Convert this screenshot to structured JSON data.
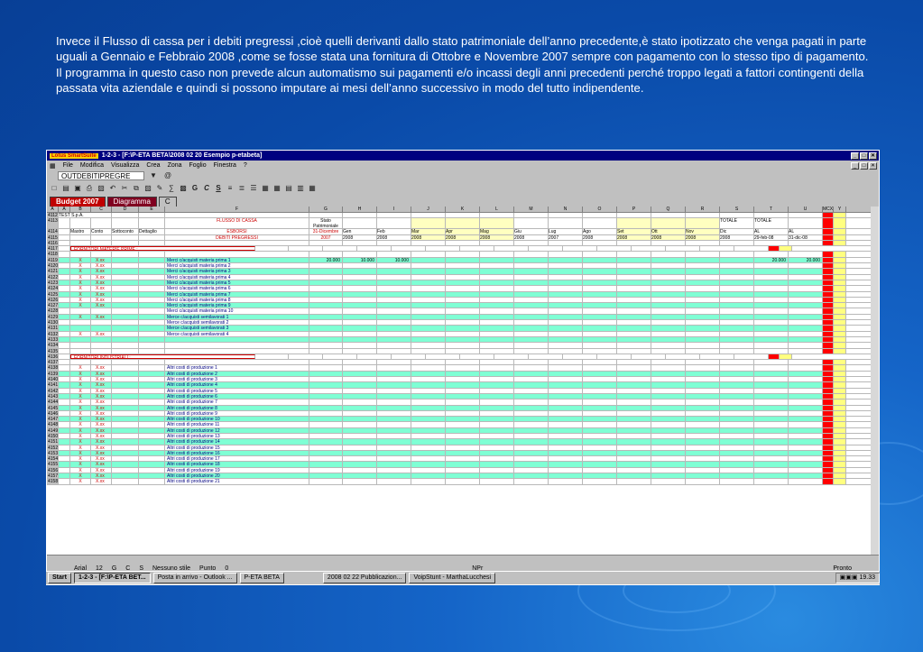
{
  "caption": "Invece il Flusso di cassa per i debiti pregressi ,cioè quelli derivanti dallo stato patrimoniale dell’anno precedente,è stato ipotizzato che venga pagati in parte uguali a Gennaio e Febbraio 2008 ,come se fosse stata una fornitura di Ottobre e Novembre 2007 sempre con pagamento con lo stesso tipo di pagamento. Il programma in questo caso non prevede alcun automatismo sui pagamenti e/o incassi degli anni precedenti perché troppo legati a fattori contingenti della passata vita aziendale e quindi si possono imputare ai mesi dell’anno successivo in modo del tutto indipendente.",
  "window": {
    "title": "1-2-3 - [F:\\P-ETA BETA\\2008 02 20 Esempio p-etabeta]",
    "logo_text": "Lotus SmartSuite"
  },
  "menu": [
    "File",
    "Modifica",
    "Visualizza",
    "Crea",
    "Zona",
    "Foglio",
    "Finestra",
    "?"
  ],
  "name_box": "OUTDEBITIPREGRE",
  "toolbar_letters": {
    "bold": "G",
    "italic": "C",
    "underline": "S"
  },
  "tabs": [
    "Budget 2007",
    "Diagramma",
    "C"
  ],
  "columns": [
    "A",
    "A",
    "B",
    "C",
    "D",
    "E",
    "F",
    "G",
    "H",
    "I",
    "J",
    "K",
    "L",
    "M",
    "N",
    "O",
    "P",
    "Q",
    "R",
    "S",
    "T",
    "U",
    "MCX",
    "Y"
  ],
  "header": {
    "company": "TEST S.p.A.",
    "title1": "FLUSSO DI CASSA",
    "title2": "ESBORSI",
    "title3": "DEBITI PREGRESSI",
    "col_mastro": "Mastro",
    "col_conto": "Conto",
    "col_sottoconto": "Sottoconto",
    "col_dettaglio": "Dettaglio",
    "stato": [
      "Stato",
      "Patrimoniale",
      "31-Dicembre",
      "2007"
    ],
    "months": [
      {
        "m": "Gen",
        "y": "2008"
      },
      {
        "m": "Feb",
        "y": "2008"
      },
      {
        "m": "Mar",
        "y": "2008"
      },
      {
        "m": "Apr",
        "y": "2008"
      },
      {
        "m": "Mag",
        "y": "2008"
      },
      {
        "m": "Giu",
        "y": "2008"
      },
      {
        "m": "Lug",
        "y": "2007"
      },
      {
        "m": "Ago",
        "y": "2008"
      },
      {
        "m": "Set",
        "y": "2008"
      },
      {
        "m": "Ott",
        "y": "2008"
      },
      {
        "m": "Nov",
        "y": "2008"
      },
      {
        "m": "Dic",
        "y": "2008"
      }
    ],
    "totale1": [
      "TOTALE",
      "AL",
      "29-feb-08"
    ],
    "totale2": [
      "TOTALE",
      "AL",
      "31-dic-08"
    ]
  },
  "section1": "FORNITORI MATERIE PRIME :",
  "section2": "FORNITORI INDUSTRIALI :",
  "row_numbers": [
    "4112",
    "4113",
    "4114",
    "4115",
    "4116",
    "4117",
    "4118",
    "4119",
    "4120",
    "4121",
    "4122",
    "4123",
    "4124",
    "4125",
    "4126",
    "4127",
    "4128",
    "4129",
    "4130",
    "4131",
    "4132",
    "4133",
    "4134",
    "4135",
    "4136",
    "4137",
    "4138",
    "4139",
    "4140",
    "4141",
    "4142",
    "4143",
    "4144",
    "4145",
    "4146",
    "4147",
    "4148",
    "4149",
    "4150",
    "4151",
    "4152",
    "4153",
    "4154",
    "4155",
    "4156",
    "4157",
    "4158"
  ],
  "mat_rows": [
    {
      "x": "X",
      "c": "X.xx",
      "d": "Merci c/acquisti materia prima 1",
      "g": "20.000",
      "h": "10.000",
      "i": "10.000",
      "t": "20.000",
      "u": "20.000"
    },
    {
      "x": "X",
      "c": "X.xx",
      "d": "Merci c/acquisti materia prima 2"
    },
    {
      "x": "X",
      "c": "X.xx",
      "d": "Merci c/acquisti materia prima 3"
    },
    {
      "x": "X",
      "c": "X.xx",
      "d": "Merci c/acquisti materia prima 4"
    },
    {
      "x": "X",
      "c": "X.xx",
      "d": "Merci c/acquisti materia prima 5"
    },
    {
      "x": "X",
      "c": "X.xx",
      "d": "Merci c/acquisti materia prima 6"
    },
    {
      "x": "X",
      "c": "X.xx",
      "d": "Merci c/acquisti materia prima 7"
    },
    {
      "x": "X",
      "c": "X.xx",
      "d": "Merci c/acquisti materia prima 8"
    },
    {
      "x": "X",
      "c": "X.xx",
      "d": "Merci c/acquisti materia prima 9"
    },
    {
      "x": "",
      "c": "",
      "d": "Merci c/acquisti materia prima 10"
    },
    {
      "x": "X",
      "c": "X.xx",
      "d": "Merce c/acquisti semilavorati 1"
    },
    {
      "x": "",
      "c": "",
      "d": "Merce c/acquisti semilavorati 2"
    },
    {
      "x": "",
      "c": "",
      "d": "Merce c/acquisti semilavorati 3"
    },
    {
      "x": "X",
      "c": "X.xx",
      "d": "Merce c/acquisti semilavorati 4"
    }
  ],
  "ind_rows": [
    {
      "x": "X",
      "c": "X.xx",
      "d": "Altri costi di produzione 1"
    },
    {
      "x": "X",
      "c": "X.xx",
      "d": "Altri costi di produzione 2"
    },
    {
      "x": "X",
      "c": "X.xx",
      "d": "Altri costi di produzione 3"
    },
    {
      "x": "X",
      "c": "X.xx",
      "d": "Altri costi di produzione 4"
    },
    {
      "x": "X",
      "c": "X.xx",
      "d": "Altri costi di produzione 5"
    },
    {
      "x": "X",
      "c": "X.xx",
      "d": "Altri costi di produzione 6"
    },
    {
      "x": "X",
      "c": "X.xx",
      "d": "Altri costi di produzione 7"
    },
    {
      "x": "X",
      "c": "X.xx",
      "d": "Altri costi di produzione 8"
    },
    {
      "x": "X",
      "c": "X.xx",
      "d": "Altri costi di produzione 9"
    },
    {
      "x": "X",
      "c": "X.xx",
      "d": "Altri costi di produzione 10"
    },
    {
      "x": "X",
      "c": "X.xx",
      "d": "Altri costi di produzione 11"
    },
    {
      "x": "X",
      "c": "X.xx",
      "d": "Altri costi di produzione 12"
    },
    {
      "x": "X",
      "c": "X.xx",
      "d": "Altri costi di produzione 13"
    },
    {
      "x": "X",
      "c": "X.xx",
      "d": "Altri costi di produzione 14"
    },
    {
      "x": "X",
      "c": "X.xx",
      "d": "Altri costi di produzione 15"
    },
    {
      "x": "X",
      "c": "X.xx",
      "d": "Altri costi di produzione 16"
    },
    {
      "x": "X",
      "c": "X.xx",
      "d": "Altri costi di produzione 17"
    },
    {
      "x": "X",
      "c": "X.xx",
      "d": "Altri costi di produzione 18"
    },
    {
      "x": "X",
      "c": "X.xx",
      "d": "Altri costi di produzione 19"
    },
    {
      "x": "X",
      "c": "X.xx",
      "d": "Altri costi di produzione 20"
    },
    {
      "x": "X",
      "c": "X.xx",
      "d": "Altri costi di produzione 21"
    }
  ],
  "status": {
    "font": "Arial",
    "size": "12",
    "style": "Nessuno stile",
    "format": "Punto",
    "zero": "0",
    "mode": "NPr",
    "ready": "Pronto"
  },
  "taskbar": {
    "start": "Start",
    "items": [
      "1-2-3 - [F:\\P-ETA BET...",
      "Posta in arrivo - Outlook ...",
      "P-ETA BETA",
      "2008 02 22 Pubblicazion...",
      "VoipStunt - MarthaLucchesi"
    ],
    "clock": "19.33"
  },
  "colors": {
    "accent_row": "#7fffd4",
    "highlight": "#ffffc0",
    "red": "#ff0000",
    "title_bar": "#000080"
  }
}
